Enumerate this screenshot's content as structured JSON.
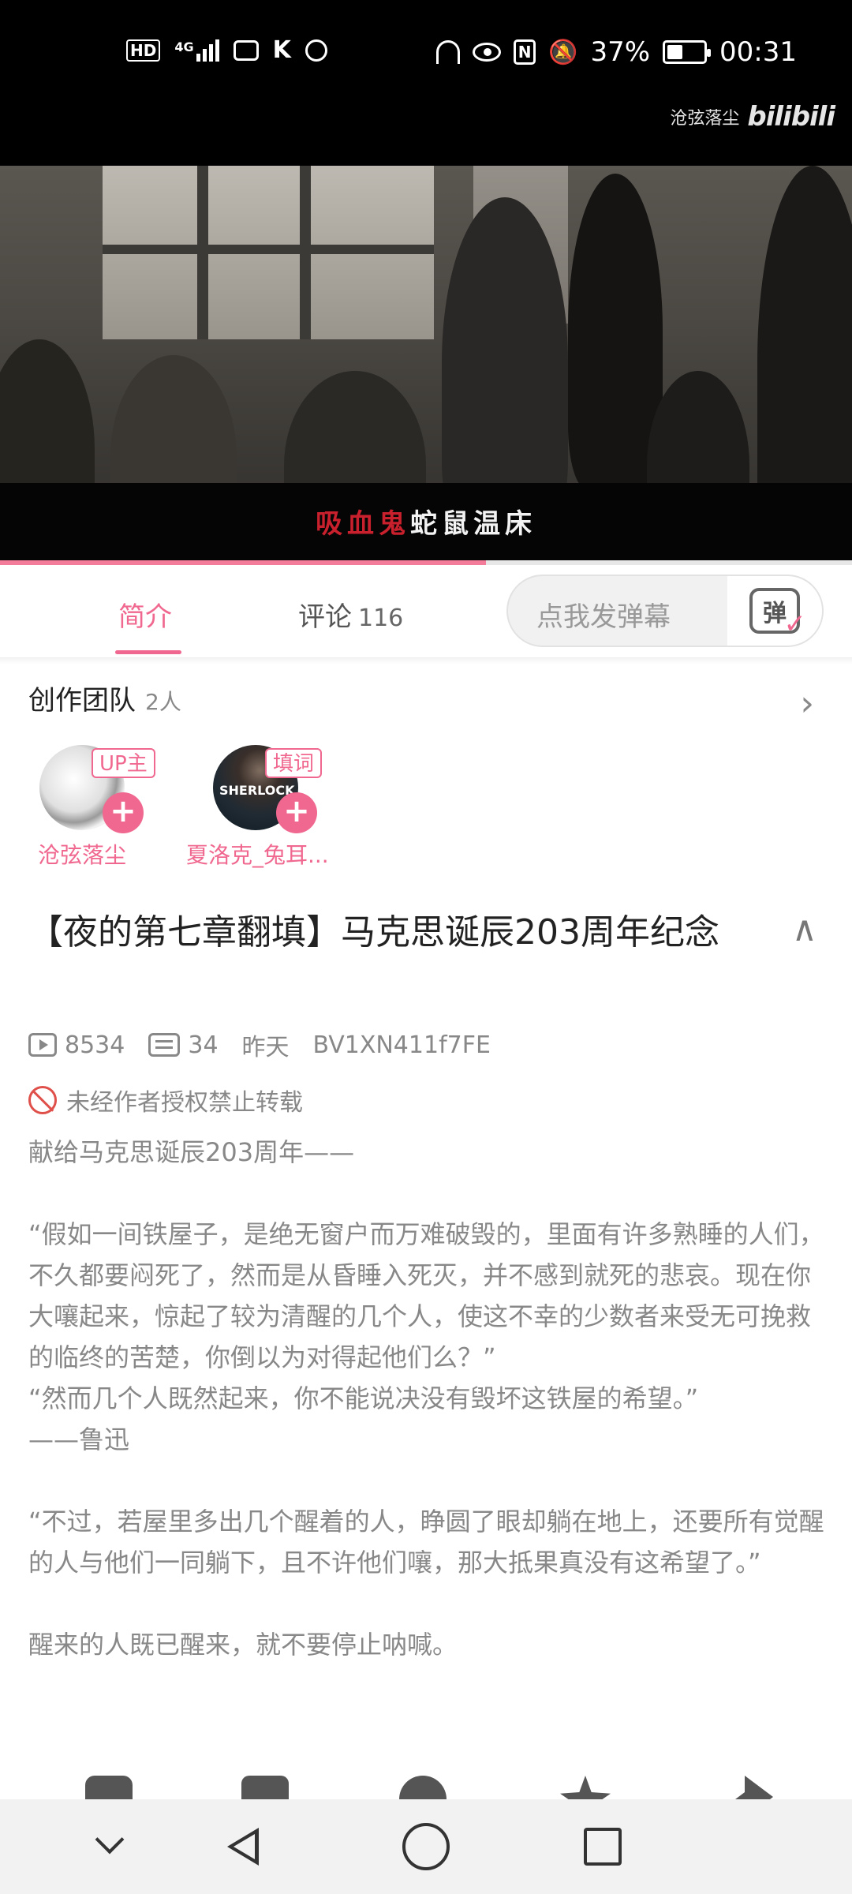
{
  "status_bar": {
    "left_icons": [
      "hd-icon",
      "4g-signal-icon",
      "bilibili-tv-icon",
      "k-icon",
      "hotspot-icon"
    ],
    "hd_label": "HD",
    "net_label": "4G",
    "battery_percent": "37%",
    "battery_level": 0.37,
    "time": "00:31"
  },
  "video": {
    "watermark_author": "沧弦落尘",
    "watermark_brand": "bilibili",
    "subtitle_red": "吸血鬼",
    "subtitle_white": "蛇鼠温床",
    "progress": 0.57
  },
  "tabs": [
    {
      "label": "简介",
      "active": true
    },
    {
      "label": "评论",
      "count": "116",
      "active": false
    }
  ],
  "danmaku": {
    "placeholder": "点我发弹幕",
    "button_glyph": "弹"
  },
  "team": {
    "title": "创作团队",
    "count": "2人",
    "members": [
      {
        "name": "沧弦落尘",
        "role": "UP主"
      },
      {
        "name": "夏洛克_兔耳...",
        "role": "填词",
        "avatar_text": "SHERLOCK"
      }
    ]
  },
  "video_info": {
    "title": "【夜的第七章翻填】马克思诞辰203周年纪念",
    "views": "8534",
    "danmaku_count": "34",
    "date": "昨天",
    "bvid": "BV1XN411f7FE",
    "copyright": "未经作者授权禁止转载",
    "description": [
      "献给马克思诞辰203周年——",
      "",
      "“假如一间铁屋子，是绝无窗户而万难破毁的，里面有许多熟睡的人们，不久都要闷死了，然而是从昏睡入死灭，并不感到就死的悲哀。现在你大嚷起来，惊起了较为清醒的几个人，使这不幸的少数者来受无可挽救的临终的苦楚，你倒以为对得起他们么？”",
      "“然而几个人既然起来，你不能说决没有毁坏这铁屋的希望。”",
      "——鲁迅",
      "",
      "“不过，若屋里多出几个醒着的人，睁圆了眼却躺在地上，还要所有觉醒的人与他们一同躺下，且不许他们嚷，那大抵果真没有这希望了。”",
      "",
      "醒来的人既已醒来，就不要停止呐喊。"
    ]
  },
  "colors": {
    "accent": "#f0688f",
    "text_secondary": "#888888",
    "ban_red": "#e0504b"
  }
}
